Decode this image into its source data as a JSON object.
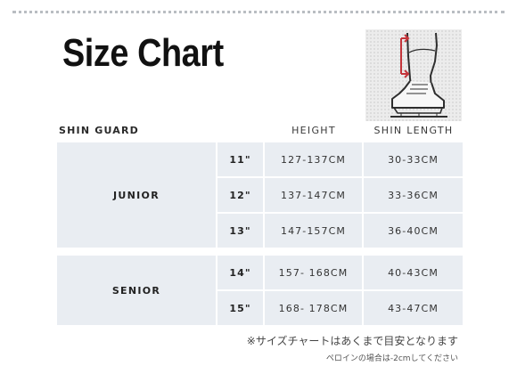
{
  "title": "Size Chart",
  "illustration": {
    "icon": "leg-skate-measurement-icon",
    "accent_color": "#c4343a"
  },
  "table": {
    "section_label": "SHIN GUARD",
    "columns": {
      "height": "HEIGHT",
      "shin_length": "SHIN LENGTH"
    },
    "groups": [
      {
        "name": "JUNIOR",
        "rows": [
          {
            "size": "11\"",
            "height": "127-137CM",
            "shin_length": "30-33CM"
          },
          {
            "size": "12\"",
            "height": "137-147CM",
            "shin_length": "33-36CM"
          },
          {
            "size": "13\"",
            "height": "147-157CM",
            "shin_length": "36-40CM"
          }
        ]
      },
      {
        "name": "SENIOR",
        "rows": [
          {
            "size": "14\"",
            "height": "157- 168CM",
            "shin_length": "40-43CM"
          },
          {
            "size": "15\"",
            "height": "168- 178CM",
            "shin_length": "43-47CM"
          }
        ]
      }
    ]
  },
  "notes": {
    "main": "※サイズチャートはあくまで目安となります",
    "sub": "ペロインの場合は-2cmしてください"
  },
  "colors": {
    "cell_background": "#e9edf2",
    "title": "#111111"
  }
}
